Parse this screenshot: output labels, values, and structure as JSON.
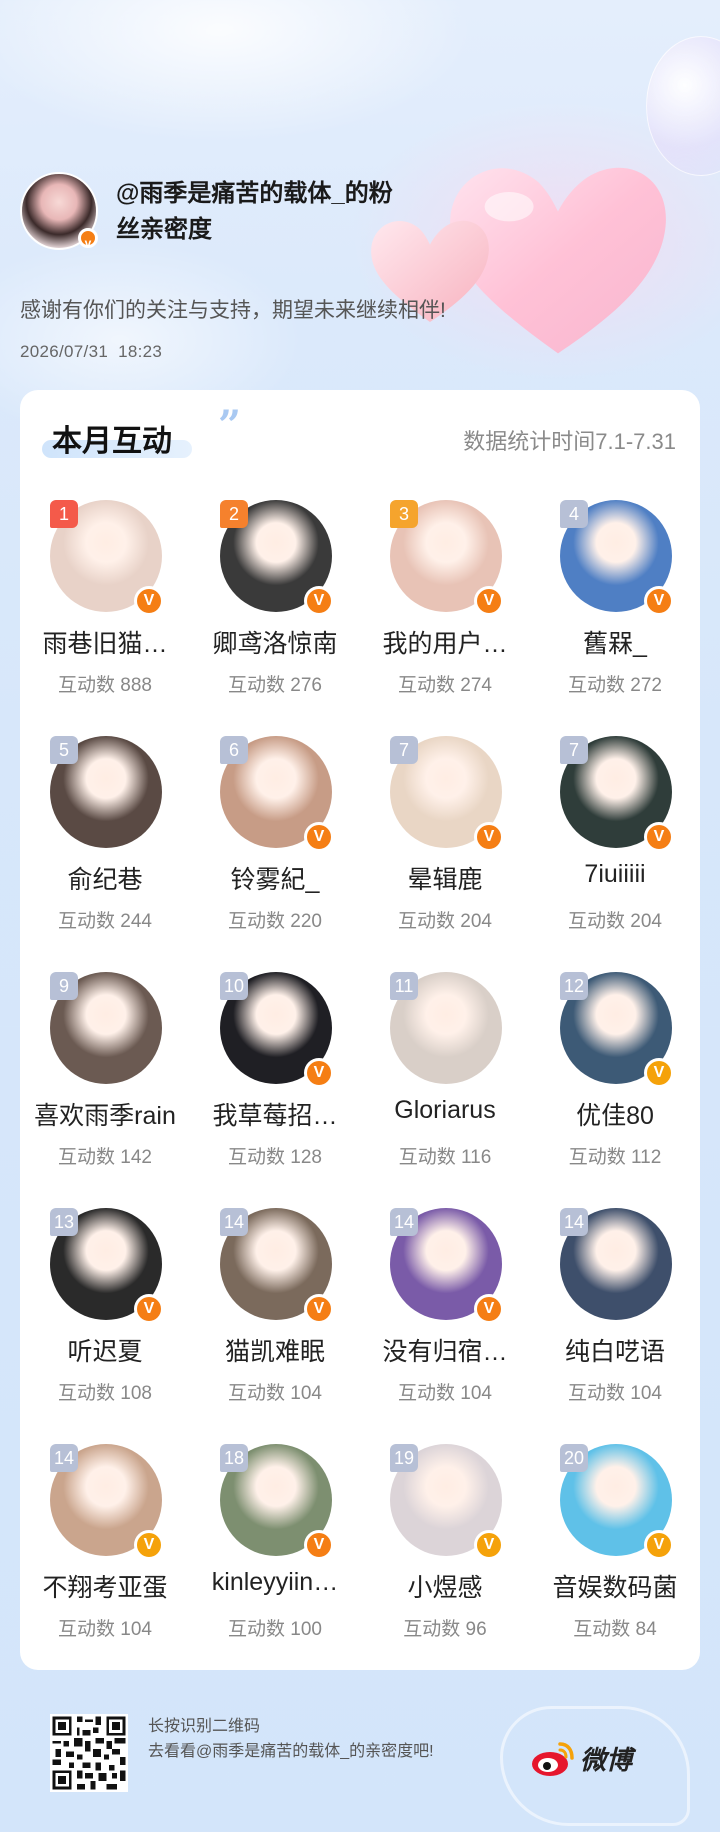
{
  "header": {
    "title": "@雨季是痛苦的载体_的粉丝亲密度",
    "thanks": "感谢有你们的关注与支持，期望未来继续相伴!",
    "datetime": "2026/07/31  18:23"
  },
  "card": {
    "title": "本月互动",
    "period": "数据统计时间7.1-7.31",
    "fans": [
      {
        "rank": "1",
        "name": "雨巷旧猫…",
        "count": "互动数 888",
        "rank_color": "#f45a4a",
        "avatar_color": "#e8d2c8",
        "badge": "V",
        "icon": "avatar-icon"
      },
      {
        "rank": "2",
        "name": "卿鸢洛惊南",
        "count": "互动数 276",
        "rank_color": "#f5812d",
        "avatar_color": "#3a3a3a",
        "badge": "V",
        "icon": "avatar-icon"
      },
      {
        "rank": "3",
        "name": "我的用户…",
        "count": "互动数 274",
        "rank_color": "#f5a42d",
        "avatar_color": "#e8c3b6",
        "badge": "V",
        "icon": "avatar-icon"
      },
      {
        "rank": "4",
        "name": "舊槑_",
        "count": "互动数 272",
        "rank_color": "#b7c0d6",
        "avatar_color": "#4f7fc4",
        "badge": "V",
        "icon": "avatar-icon"
      },
      {
        "rank": "5",
        "name": "俞纪巷",
        "count": "互动数 244",
        "rank_color": "#b7c0d6",
        "avatar_color": "#5a4a44",
        "badge": "",
        "icon": "avatar-icon"
      },
      {
        "rank": "6",
        "name": "铃雾紀_",
        "count": "互动数 220",
        "rank_color": "#b7c0d6",
        "avatar_color": "#c79c86",
        "badge": "V",
        "icon": "avatar-icon"
      },
      {
        "rank": "7",
        "name": "晕辑鹿",
        "count": "互动数 204",
        "rank_color": "#b7c0d6",
        "avatar_color": "#e9d6c5",
        "badge": "V",
        "icon": "avatar-icon"
      },
      {
        "rank": "7",
        "name": "7iuiiiii",
        "count": "互动数 204",
        "rank_color": "#b7c0d6",
        "avatar_color": "#2f3d3a",
        "badge": "V",
        "icon": "avatar-icon"
      },
      {
        "rank": "9",
        "name": "喜欢雨季rain",
        "count": "互动数 142",
        "rank_color": "#b7c0d6",
        "avatar_color": "#6b5a52",
        "badge": "",
        "icon": "avatar-icon"
      },
      {
        "rank": "10",
        "name": "我草莓招…",
        "count": "互动数 128",
        "rank_color": "#b7c0d6",
        "avatar_color": "#1f1f24",
        "badge": "V",
        "icon": "avatar-icon"
      },
      {
        "rank": "11",
        "name": "Gloriarus",
        "count": "互动数 116",
        "rank_color": "#b7c0d6",
        "avatar_color": "#d9cfc8",
        "badge": "",
        "icon": "avatar-icon"
      },
      {
        "rank": "12",
        "name": "优佳80",
        "count": "互动数 112",
        "rank_color": "#b7c0d6",
        "avatar_color": "#3d5a76",
        "badge": "V",
        "gold": true,
        "icon": "avatar-icon"
      },
      {
        "rank": "13",
        "name": "听迟夏",
        "count": "互动数 108",
        "rank_color": "#b7c0d6",
        "avatar_color": "#2a2a2a",
        "badge": "V",
        "icon": "avatar-icon"
      },
      {
        "rank": "14",
        "name": "猫凯难眠",
        "count": "互动数 104",
        "rank_color": "#b7c0d6",
        "avatar_color": "#7b6a5c",
        "badge": "V",
        "icon": "avatar-icon"
      },
      {
        "rank": "14",
        "name": "没有归宿…",
        "count": "互动数 104",
        "rank_color": "#b7c0d6",
        "avatar_color": "#7a5ba8",
        "badge": "V",
        "icon": "avatar-icon"
      },
      {
        "rank": "14",
        "name": "纯白呓语",
        "count": "互动数 104",
        "rank_color": "#b7c0d6",
        "avatar_color": "#3e4f6b",
        "badge": "",
        "icon": "avatar-icon"
      },
      {
        "rank": "14",
        "name": "不翔考亚蛋",
        "count": "互动数 104",
        "rank_color": "#b7c0d6",
        "avatar_color": "#caa58d",
        "badge": "V",
        "gold": true,
        "icon": "avatar-icon"
      },
      {
        "rank": "18",
        "name": "kinleyyiin…",
        "count": "互动数 100",
        "rank_color": "#b7c0d6",
        "avatar_color": "#7d8f70",
        "badge": "V",
        "icon": "avatar-icon"
      },
      {
        "rank": "19",
        "name": "小煜感",
        "count": "互动数 96",
        "rank_color": "#b7c0d6",
        "avatar_color": "#dcd4d8",
        "badge": "V",
        "gold": true,
        "icon": "avatar-icon"
      },
      {
        "rank": "20",
        "name": "音娱数码菌",
        "count": "互动数 84",
        "rank_color": "#b7c0d6",
        "avatar_color": "#5fc1e8",
        "badge": "V",
        "gold": true,
        "icon": "avatar-icon"
      }
    ]
  },
  "footer": {
    "line1": "长按识别二维码",
    "line2": "去看看@雨季是痛苦的载体_的亲密度吧!",
    "brand": "微博"
  },
  "colors": {
    "accent_orange": "#f57e14",
    "accent_gold": "#f5a20a",
    "weibo_red": "#e6162d"
  }
}
